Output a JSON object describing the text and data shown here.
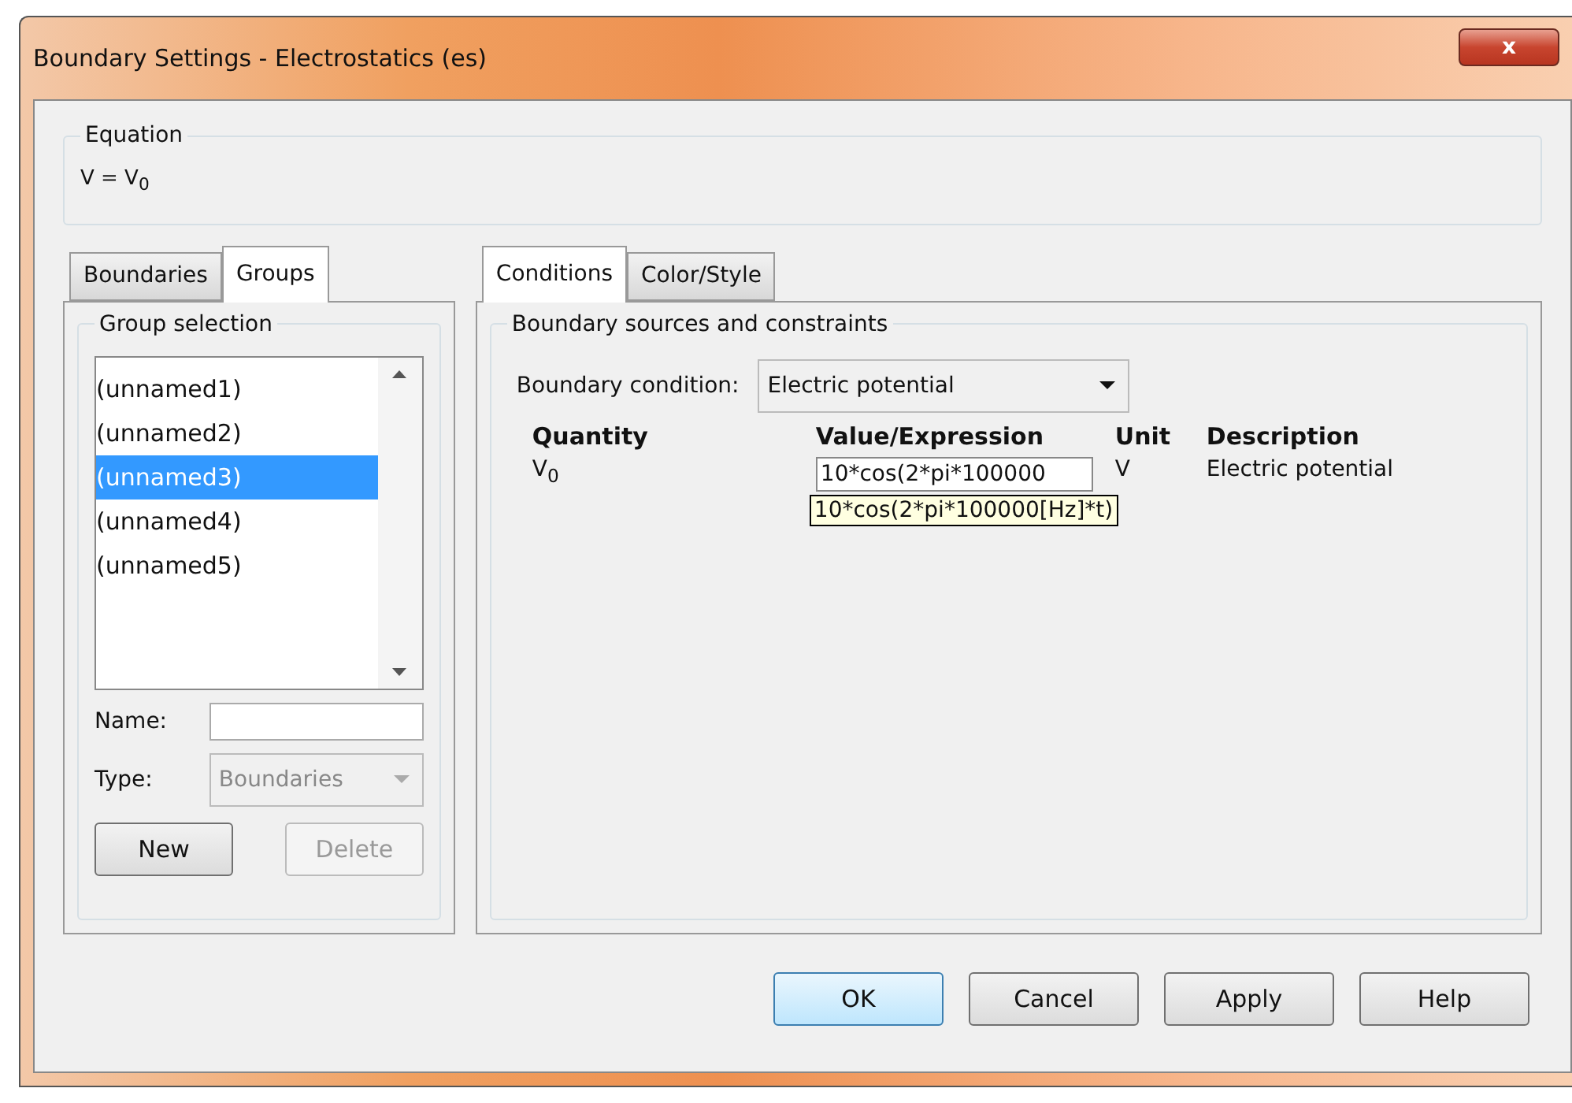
{
  "window": {
    "title": "Boundary Settings - Electrostatics (es)",
    "close": "x"
  },
  "equation": {
    "legend": "Equation",
    "formula": "V = V$_{0}$"
  },
  "left_tabs": [
    {
      "label": "Boundaries",
      "selected": false
    },
    {
      "label": "Groups",
      "selected": true
    }
  ],
  "group_selection": {
    "legend": "Group selection",
    "items": [
      {
        "label": "(unnamed1)",
        "selected": false
      },
      {
        "label": "(unnamed2)",
        "selected": false
      },
      {
        "label": "(unnamed3)",
        "selected": true
      },
      {
        "label": "(unnamed4)",
        "selected": false
      },
      {
        "label": "(unnamed5)",
        "selected": false
      }
    ],
    "name_label": "Name:",
    "type_label": "Type:",
    "type_value": "Boundaries",
    "type_disabled": true,
    "buttons": [
      {
        "label": "New",
        "disabled": false
      },
      {
        "label": "Delete",
        "disabled": true
      }
    ]
  },
  "right_tabs": [
    {
      "label": "Conditions",
      "selected": true
    },
    {
      "label": "Color/Style",
      "selected": false
    }
  ],
  "sources": {
    "legend": "Boundary sources and constraints",
    "condition_label": "Boundary condition:",
    "condition_value": "Electric potential",
    "columns": [
      "Quantity",
      "Value/Expression",
      "Unit",
      "Description"
    ],
    "rows": [
      {
        "quantity": "V$_{0}$",
        "value": "10*cos(2*pi*100000",
        "unit": "V",
        "description": "Electric potential"
      }
    ],
    "tooltip": "10*cos(2*pi*100000[Hz]*t)"
  },
  "buttons": [
    {
      "label": "OK",
      "default": true
    },
    {
      "label": "Cancel",
      "default": false
    },
    {
      "label": "Apply",
      "default": false
    },
    {
      "label": "Help",
      "default": false
    }
  ]
}
